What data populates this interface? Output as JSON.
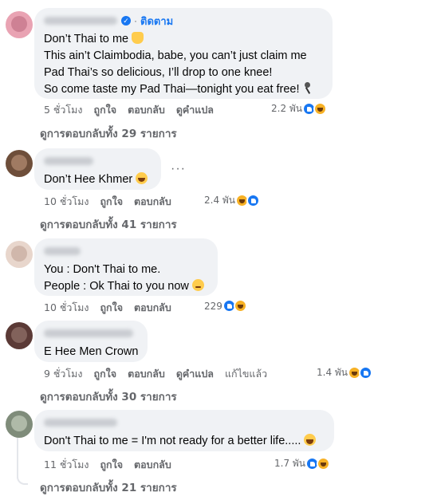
{
  "comments": [
    {
      "lines": [
        "Don’t Thai to me",
        "This ain’t Claimbodia, babe, you can’t just claim me",
        "Pad Thai’s so delicious, I’ll drop to one knee!",
        "So come taste my Pad Thai—tonight you eat free!"
      ],
      "follow_label": "ติดตาม",
      "time": "5 ชั่วโมง",
      "like": "ถูกใจ",
      "reply": "ตอบกลับ",
      "translate": "ดูคำแปล",
      "reaction_count": "2.2 พัน",
      "view_replies": "ดูการตอบกลับทั้ง 29 รายการ",
      "avatar_colors": [
        "#e9a3b3",
        "#c97b8e"
      ]
    },
    {
      "lines": [
        "Don’t Hee Khmer"
      ],
      "more": "···",
      "time": "10 ชั่วโมง",
      "like": "ถูกใจ",
      "reply": "ตอบกลับ",
      "reaction_count": "2.4 พัน",
      "view_replies": "ดูการตอบกลับทั้ง 41 รายการ",
      "avatar_colors": [
        "#6e4e3a",
        "#a9826a"
      ]
    },
    {
      "lines": [
        "You : Don't Thai to me.",
        "People : Ok Thai to you now"
      ],
      "time": "10 ชั่วโมง",
      "like": "ถูกใจ",
      "reply": "ตอบกลับ",
      "reaction_count": "229",
      "avatar_colors": [
        "#e8d6cc",
        "#cbb2a5"
      ]
    },
    {
      "lines": [
        "E Hee Men Crown"
      ],
      "time": "9 ชั่วโมง",
      "like": "ถูกใจ",
      "reply": "ตอบกลับ",
      "translate": "ดูคำแปล",
      "edited": "แก้ไขแล้ว",
      "reaction_count": "1.4 พัน",
      "view_replies": "ดูการตอบกลับทั้ง 30 รายการ",
      "avatar_colors": [
        "#5b3a36",
        "#8a6a62"
      ]
    },
    {
      "lines": [
        "Don't Thai to me = I'm not ready for a better life....."
      ],
      "time": "11 ชั่วโมง",
      "like": "ถูกใจ",
      "reply": "ตอบกลับ",
      "reaction_count": "1.7 พัน",
      "view_replies": "ดูการตอบกลับทั้ง 21 รายการ",
      "avatar_colors": [
        "#7f8c7a",
        "#b7c2b0"
      ]
    }
  ]
}
